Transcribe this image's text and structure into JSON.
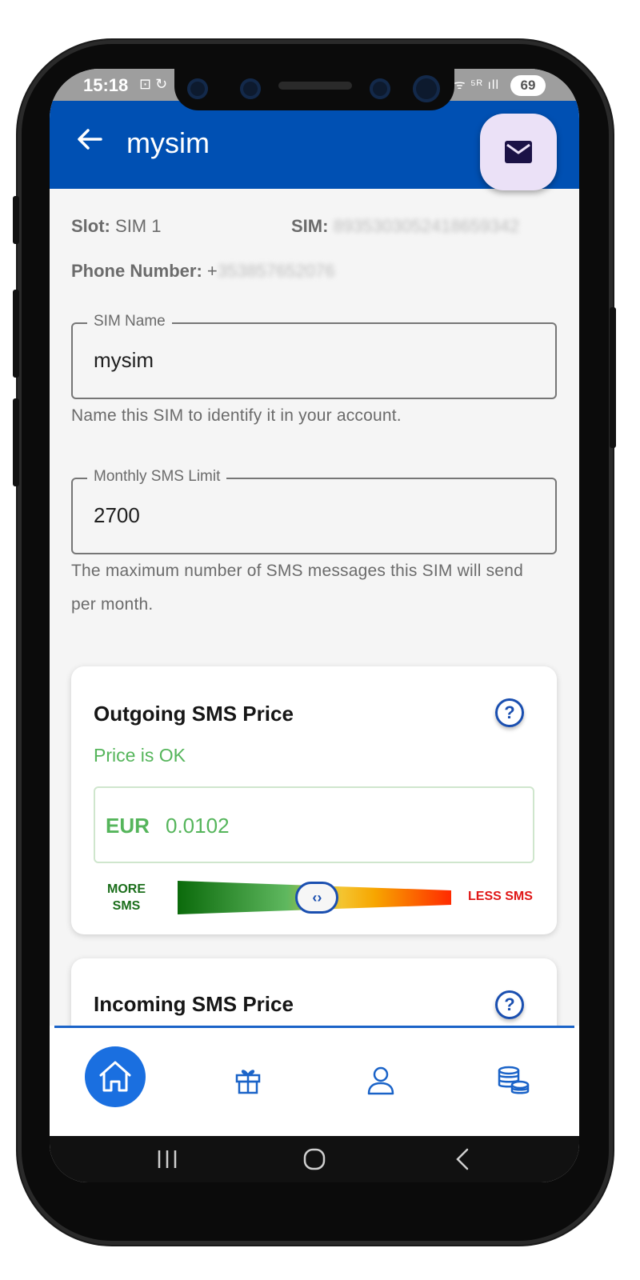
{
  "status_bar": {
    "time": "15:18",
    "left_icons": "⊡ ↻",
    "right_icons": "ᯤ ⁵ᴿ ıll",
    "battery": "69"
  },
  "app_bar": {
    "title": "mysim",
    "back_icon": "back-arrow-icon",
    "fab_icon": "mail-icon"
  },
  "sim_info": {
    "slot_label": "Slot:",
    "slot_value": "SIM 1",
    "sim_label": "SIM:",
    "sim_value": "8935303052418659342",
    "phone_label": "Phone Number:",
    "phone_prefix": "+",
    "phone_value": "353857652076"
  },
  "sim_name_field": {
    "label": "SIM Name",
    "value": "mysim",
    "helper": "Name this SIM to identify it in your account."
  },
  "sms_limit_field": {
    "label": "Monthly SMS Limit",
    "value": "2700",
    "helper": "The maximum number of SMS messages this SIM will send per month."
  },
  "outgoing_card": {
    "title": "Outgoing SMS Price",
    "status": "Price is OK",
    "currency": "EUR",
    "price": "0.0102",
    "slider_left_label": "MORE SMS",
    "slider_right_label": "LESS SMS",
    "slider_position": 0.51,
    "thumb_glyph": "‹›",
    "help_glyph": "?"
  },
  "incoming_card": {
    "title": "Incoming SMS Price",
    "help_glyph": "?"
  },
  "bottom_nav": {
    "items": [
      "home-icon",
      "gift-icon",
      "user-icon",
      "coins-icon"
    ],
    "active": "home-icon"
  },
  "colors": {
    "app_bar": "#0050b3",
    "accent": "#1a4fb0",
    "ok_green": "#55b55b",
    "danger_red": "#e01717"
  }
}
